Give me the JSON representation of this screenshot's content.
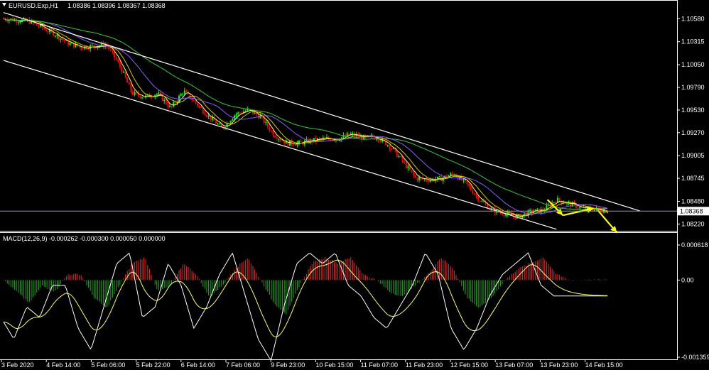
{
  "header": {
    "symbol": "EURUSD.Exp,H1",
    "ohlc": "1.08386 1.08396 1.08367 1.08368",
    "arrow_icon": "triangle-down-icon"
  },
  "macd_header": "MACD(12,26,9) -0.000262 -0.000300 0.000050 0.000000",
  "colors": {
    "background": "#000000",
    "axis": "#ffffff",
    "bull_candle": "#00ff00",
    "bear_candle": "#ff0000",
    "ma_fast": "#ffff66",
    "ma_mid": "#cccc00",
    "ma_slow": "#8a5cff",
    "ma_long": "#33cc33",
    "channel": "#ffffff",
    "macd_pos": "#e03030",
    "macd_neg": "#2aa02a",
    "macd_line": "#ffffff",
    "signal_line": "#ffff66",
    "arrows": "#ffff00",
    "current_price_line": "#8a9ab8"
  },
  "chart_data": [
    {
      "type": "candlestick",
      "title": "EURUSD.Exp,H1",
      "price_axis_ticks": [
        "1.10580",
        "1.10315",
        "1.10050",
        "1.09790",
        "1.09530",
        "1.09270",
        "1.09005",
        "1.08745",
        "1.08480",
        "1.08220"
      ],
      "current_price": "1.08368",
      "ylim": [
        1.0815,
        1.1068
      ],
      "time_axis_ticks": [
        "3 Feb 2020",
        "4 Feb 14:00",
        "5 Feb 06:00",
        "5 Feb 22:00",
        "6 Feb 14:00",
        "7 Feb 06:00",
        "9 Feb 23:00",
        "10 Feb 15:00",
        "11 Feb 07:00",
        "11 Feb 23:00",
        "12 Feb 15:00",
        "13 Feb 07:00",
        "13 Feb 23:00",
        "14 Feb 15:00"
      ],
      "price_path": [
        [
          0,
          1.1058
        ],
        [
          2,
          1.1055
        ],
        [
          4,
          1.104
        ],
        [
          5,
          1.103
        ],
        [
          6,
          1.1025
        ],
        [
          8,
          1.1028
        ],
        [
          9,
          1.1005
        ],
        [
          10,
          1.0972
        ],
        [
          11,
          1.0968
        ],
        [
          12,
          1.0972
        ],
        [
          13,
          1.0955
        ],
        [
          14,
          1.0975
        ],
        [
          15,
          1.096
        ],
        [
          16,
          1.0945
        ],
        [
          17,
          1.0932
        ],
        [
          18,
          1.0948
        ],
        [
          19,
          1.0953
        ],
        [
          20,
          1.0945
        ],
        [
          21,
          1.0925
        ],
        [
          22,
          1.0915
        ],
        [
          23,
          1.0915
        ],
        [
          24,
          1.0918
        ],
        [
          25,
          1.092
        ],
        [
          26,
          1.092
        ],
        [
          27,
          1.0925
        ],
        [
          28,
          1.0921
        ],
        [
          29,
          1.0922
        ],
        [
          30,
          1.0912
        ],
        [
          31,
          1.0895
        ],
        [
          32,
          1.0875
        ],
        [
          33,
          1.0873
        ],
        [
          34,
          1.0874
        ],
        [
          35,
          1.088
        ],
        [
          36,
          1.0868
        ],
        [
          37,
          1.085
        ],
        [
          38,
          1.0838
        ],
        [
          39,
          1.0834
        ],
        [
          40,
          1.083
        ],
        [
          41,
          1.0836
        ],
        [
          42,
          1.0838
        ],
        [
          43,
          1.085
        ],
        [
          44,
          1.0845
        ],
        [
          45,
          1.084
        ],
        [
          46,
          1.0839
        ],
        [
          47,
          1.0837
        ]
      ],
      "channel_lines": [
        {
          "name": "upper",
          "points": [
            [
              0,
              1.1065
            ],
            [
              49.5,
              1.0837
            ]
          ]
        },
        {
          "name": "lower",
          "points": [
            [
              0,
              1.101
            ],
            [
              43,
              1.0816
            ]
          ]
        }
      ],
      "arrows": [
        [
          [
            42.3,
            1.085
          ],
          [
            43.5,
            1.0832
          ]
        ],
        [
          [
            43.5,
            1.0832
          ],
          [
            45.9,
            1.084
          ]
        ],
        [
          [
            46.2,
            1.0838
          ],
          [
            47.7,
            1.0812
          ]
        ]
      ]
    },
    {
      "type": "histogram",
      "title": "MACD(12,26,9)",
      "values_text": [
        "-0.000262",
        "-0.000300",
        "0.000050",
        "0.000000"
      ],
      "axis_ticks": [
        "0.000618",
        "0.00",
        "-0.001359"
      ],
      "ylim": [
        -0.001359,
        0.000618
      ],
      "histogram_path": [
        [
          0,
          0.0
        ],
        [
          1,
          -0.0002
        ],
        [
          2,
          -0.0004
        ],
        [
          3,
          -0.0001
        ],
        [
          4,
          -0.0002
        ],
        [
          5,
          0.0001
        ],
        [
          6,
          0.0001
        ],
        [
          7,
          -0.0003
        ],
        [
          8,
          -0.0005
        ],
        [
          9,
          -0.0001
        ],
        [
          10,
          0.0003
        ],
        [
          11,
          0.0004
        ],
        [
          12,
          -0.0002
        ],
        [
          13,
          -0.0001
        ],
        [
          14,
          0.0003
        ],
        [
          15,
          0.0001
        ],
        [
          16,
          -0.0003
        ],
        [
          17,
          -0.0001
        ],
        [
          18,
          0.0002
        ],
        [
          19,
          0.0004
        ],
        [
          20,
          0.0
        ],
        [
          21,
          -0.0004
        ],
        [
          22,
          -0.0006
        ],
        [
          23,
          -0.0001
        ],
        [
          24,
          0.0003
        ],
        [
          25,
          0.0004
        ],
        [
          26,
          0.0003
        ],
        [
          27,
          0.0004
        ],
        [
          28,
          0.0001
        ],
        [
          29,
          0.0
        ],
        [
          30,
          -0.0002
        ],
        [
          31,
          -0.0003
        ],
        [
          32,
          -0.0001
        ],
        [
          33,
          0.0001
        ],
        [
          34,
          0.0004
        ],
        [
          35,
          0.0002
        ],
        [
          36,
          -0.0003
        ],
        [
          37,
          -0.0005
        ],
        [
          38,
          -0.0003
        ],
        [
          39,
          0.0
        ],
        [
          40,
          0.0002
        ],
        [
          41,
          0.0003
        ],
        [
          42,
          0.0004
        ],
        [
          43,
          0.0001
        ],
        [
          44,
          0.0
        ],
        [
          45,
          0.0
        ],
        [
          46,
          0.0
        ],
        [
          47,
          0.0
        ]
      ]
    }
  ]
}
